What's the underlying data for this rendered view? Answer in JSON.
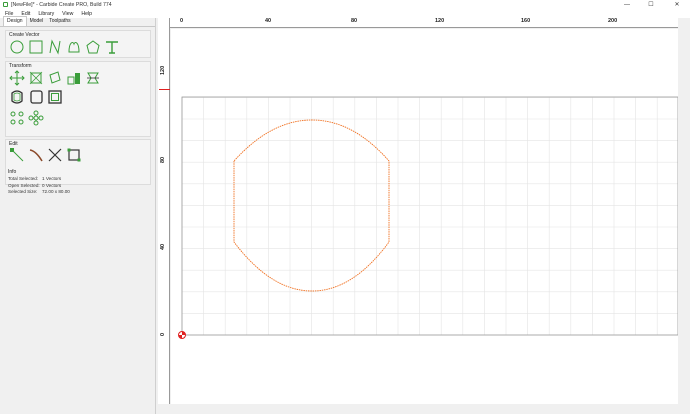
{
  "window": {
    "title": "[NewFile]* - Carbide Create PRO, Build 774",
    "controls": {
      "minimize": "—",
      "maximize": "☐",
      "close": "✕"
    }
  },
  "menu": [
    "File",
    "Edit",
    "Library",
    "View",
    "Help"
  ],
  "tabs": [
    {
      "label": "Design",
      "active": true
    },
    {
      "label": "Model",
      "active": false
    },
    {
      "label": "Toolpaths",
      "active": false
    }
  ],
  "groups": {
    "create_vector": "Create Vector",
    "transform": "Transform",
    "edit": "Edit",
    "info": "Info"
  },
  "info": {
    "total_selected_label": "Total Selected:",
    "total_selected_value": "1 Vectors",
    "open_selected_label": "Open Selected:",
    "open_selected_value": "0 Vectors",
    "selected_size_label": "Selected Size:",
    "selected_size_value": "72.00 x 80.00"
  },
  "rulers": {
    "top": [
      "0",
      "40",
      "80",
      "120",
      "160",
      "200"
    ],
    "left": [
      "120",
      "80",
      "40",
      "0"
    ]
  },
  "colors": {
    "accent_green": "#3a9d3a",
    "vector_orange": "#f07020",
    "ruler_marker": "#e02020"
  }
}
